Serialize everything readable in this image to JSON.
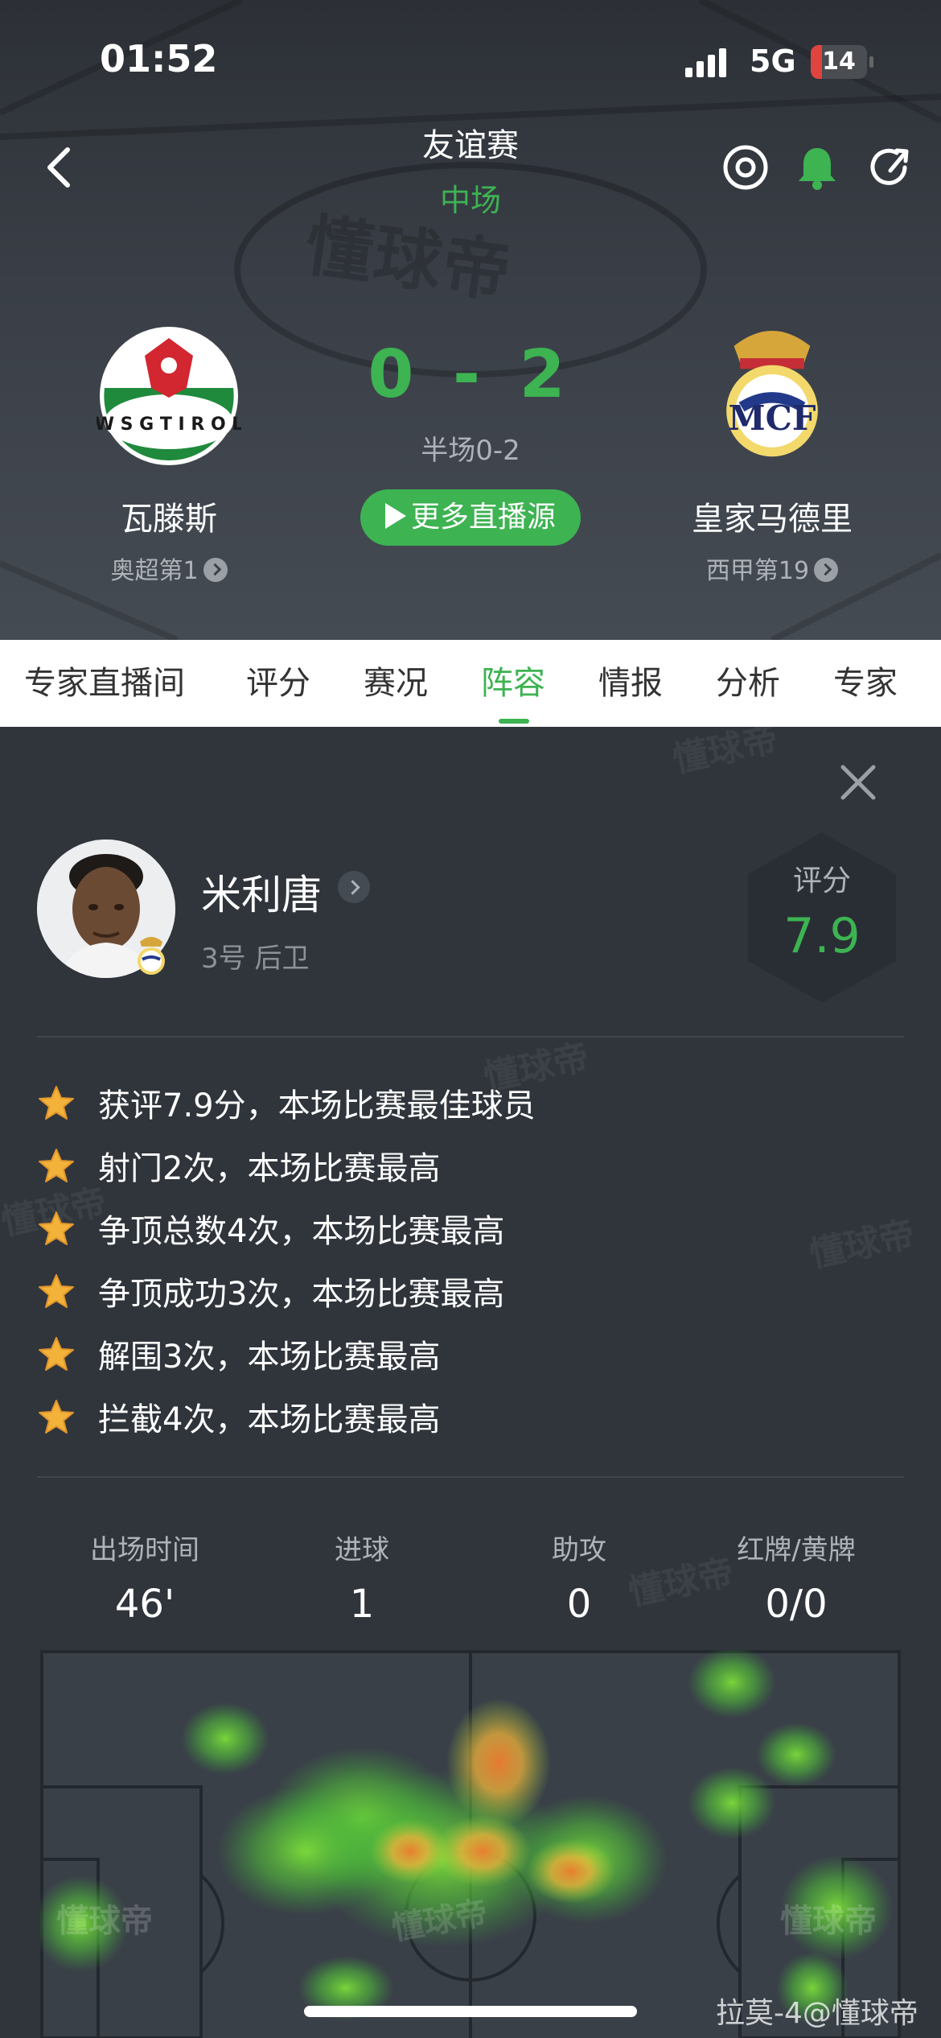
{
  "status_bar": {
    "time": "01:52",
    "network": "5G",
    "battery": "14"
  },
  "match": {
    "type": "友谊赛",
    "stage": "中场",
    "score_home": "0",
    "score_sep": "-",
    "score_away": "2",
    "half_score": "半场0-2",
    "live_button": "更多直播源"
  },
  "home_team": {
    "name": "瓦滕斯",
    "rank": "奥超第1",
    "logo_text": "W S G   T I R O L"
  },
  "away_team": {
    "name": "皇家马德里",
    "rank": "西甲第19"
  },
  "tabs": [
    "专家直播间",
    "评分",
    "赛况",
    "阵容",
    "情报",
    "分析",
    "专家"
  ],
  "active_tab": "阵容",
  "player": {
    "name": "米利唐",
    "number_position": "3号 后卫",
    "rating_label": "评分",
    "rating": "7.9"
  },
  "achievements": [
    "获评7.9分，本场比赛最佳球员",
    "射门2次，本场比赛最高",
    "争顶总数4次，本场比赛最高",
    "争顶成功3次，本场比赛最高",
    "解围3次，本场比赛最高",
    "拦截4次，本场比赛最高"
  ],
  "stats": [
    {
      "label": "出场时间",
      "value": "46'"
    },
    {
      "label": "进球",
      "value": "1"
    },
    {
      "label": "助攻",
      "value": "0"
    },
    {
      "label": "红牌/黄牌",
      "value": "0/0"
    }
  ],
  "watermark": "懂球帝",
  "credit": "拉莫-4@懂球帝",
  "colors": {
    "accent": "#3db352",
    "background": "#30353c",
    "tabbar": "#ffffff"
  }
}
